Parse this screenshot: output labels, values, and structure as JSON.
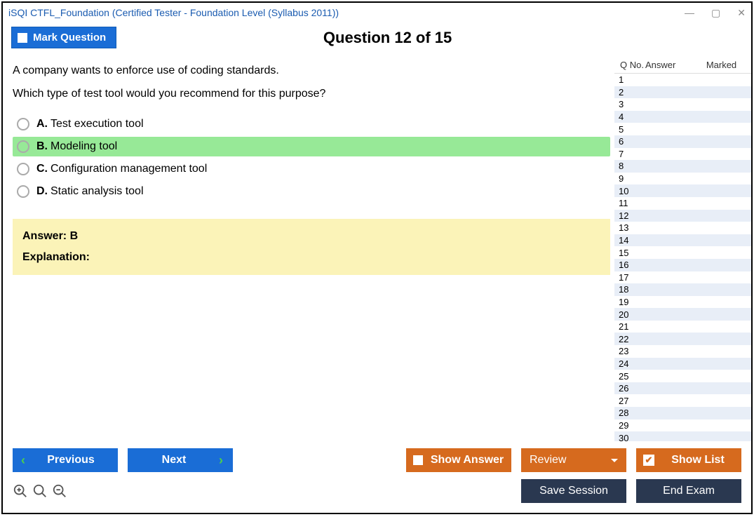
{
  "window": {
    "title": "iSQI CTFL_Foundation (Certified Tester - Foundation Level (Syllabus 2011))"
  },
  "header": {
    "mark_label": "Mark Question",
    "question_header": "Question 12 of 15"
  },
  "question": {
    "line1": "A company wants to enforce use of coding standards.",
    "line2": "Which type of test tool would you recommend for this purpose?"
  },
  "options": [
    {
      "letter": "A.",
      "text": "Test execution tool",
      "selected": false
    },
    {
      "letter": "B.",
      "text": "Modeling tool",
      "selected": true
    },
    {
      "letter": "C.",
      "text": "Configuration management tool",
      "selected": false
    },
    {
      "letter": "D.",
      "text": "Static analysis tool",
      "selected": false
    }
  ],
  "answer_panel": {
    "answer_line": "Answer: B",
    "explanation_label": "Explanation:"
  },
  "side": {
    "col_qno": "Q No.",
    "col_answer": "Answer",
    "col_marked": "Marked",
    "rows": [
      1,
      2,
      3,
      4,
      5,
      6,
      7,
      8,
      9,
      10,
      11,
      12,
      13,
      14,
      15,
      16,
      17,
      18,
      19,
      20,
      21,
      22,
      23,
      24,
      25,
      26,
      27,
      28,
      29,
      30
    ]
  },
  "footer": {
    "previous": "Previous",
    "next": "Next",
    "show_answer": "Show Answer",
    "review": "Review",
    "show_list": "Show List",
    "save_session": "Save Session",
    "end_exam": "End Exam"
  }
}
